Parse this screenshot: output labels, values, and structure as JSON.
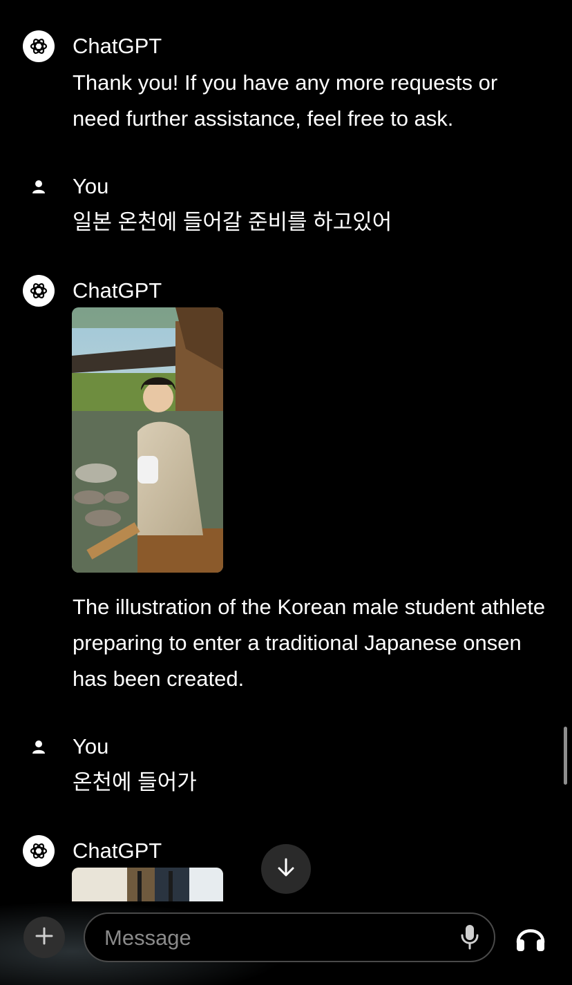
{
  "messages": [
    {
      "sender": "ChatGPT",
      "text": "Thank you! If you have any more requests or need further assistance, feel free to ask."
    },
    {
      "sender": "You",
      "text": "일본 온천에 들어갈 준비를 하고있어"
    },
    {
      "sender": "ChatGPT",
      "image_description_icon": "generated-image",
      "text": "The illustration of the Korean male student athlete preparing to enter a traditional Japanese onsen has been created."
    },
    {
      "sender": "You",
      "text": "온천에 들어가"
    },
    {
      "sender": "ChatGPT",
      "image_description_icon": "generated-image"
    }
  ],
  "composer": {
    "placeholder": "Message"
  },
  "icons": {
    "assistant_avatar": "openai-logo-icon",
    "user_avatar": "person-icon",
    "scroll_down": "arrow-down-icon",
    "add": "plus-icon",
    "mic": "microphone-icon",
    "voice": "headphones-icon"
  },
  "colors": {
    "background": "#000000",
    "text": "#ffffff",
    "placeholder": "#8a8a8a",
    "button_bg": "#2f2f2f",
    "input_border": "#4a4a4a"
  }
}
